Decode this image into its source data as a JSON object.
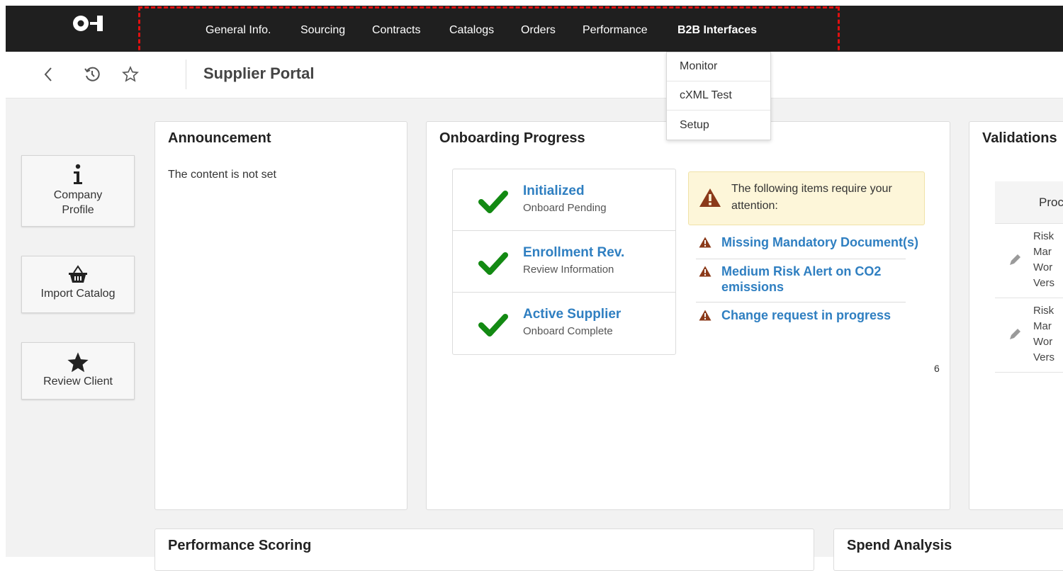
{
  "logo": {
    "icon": "oi-logo-icon"
  },
  "nav": {
    "items": [
      {
        "label": "General Info."
      },
      {
        "label": "Sourcing"
      },
      {
        "label": "Contracts"
      },
      {
        "label": "Catalogs"
      },
      {
        "label": "Orders"
      },
      {
        "label": "Performance"
      },
      {
        "label": "B2B Interfaces"
      }
    ],
    "dropdown": [
      {
        "label": "Monitor"
      },
      {
        "label": "cXML Test"
      },
      {
        "label": "Setup"
      }
    ]
  },
  "header": {
    "title": "Supplier Portal"
  },
  "tiles": [
    {
      "icon": "info-icon",
      "label_line1": "Company",
      "label_line2": "Profile"
    },
    {
      "icon": "basket-icon",
      "label": "Import Catalog"
    },
    {
      "icon": "star-icon",
      "label": "Review Client"
    }
  ],
  "announcement": {
    "title": "Announcement",
    "text": "The content is not set"
  },
  "onboarding": {
    "title": "Onboarding Progress",
    "steps": [
      {
        "title": "Initialized",
        "sub": "Onboard Pending"
      },
      {
        "title": "Enrollment Rev.",
        "sub": "Review Information"
      },
      {
        "title": "Active Supplier",
        "sub": "Onboard Complete"
      }
    ],
    "alert_text": "The following items require your attention:",
    "links": [
      {
        "line1": "Missing Mandatory Document(s)"
      },
      {
        "line1": "Medium Risk Alert on CO2",
        "line2": "emissions"
      },
      {
        "line1": "Change request in progress"
      }
    ],
    "count": "6"
  },
  "validations": {
    "title": "Validations",
    "header": "Proc",
    "rows": [
      {
        "lines": [
          "Risk",
          "Mar",
          "Wor",
          "Vers"
        ]
      },
      {
        "lines": [
          "Risk",
          "Mar",
          "Wor",
          "Vers"
        ]
      }
    ]
  },
  "performance": {
    "title": "Performance Scoring"
  },
  "spend": {
    "title": "Spend Analysis"
  },
  "colors": {
    "topbar": "#1f1f1f",
    "link": "#2f7fc1",
    "check": "#138a13",
    "warning": "#8b3a1a",
    "highlight": "#e01010"
  }
}
